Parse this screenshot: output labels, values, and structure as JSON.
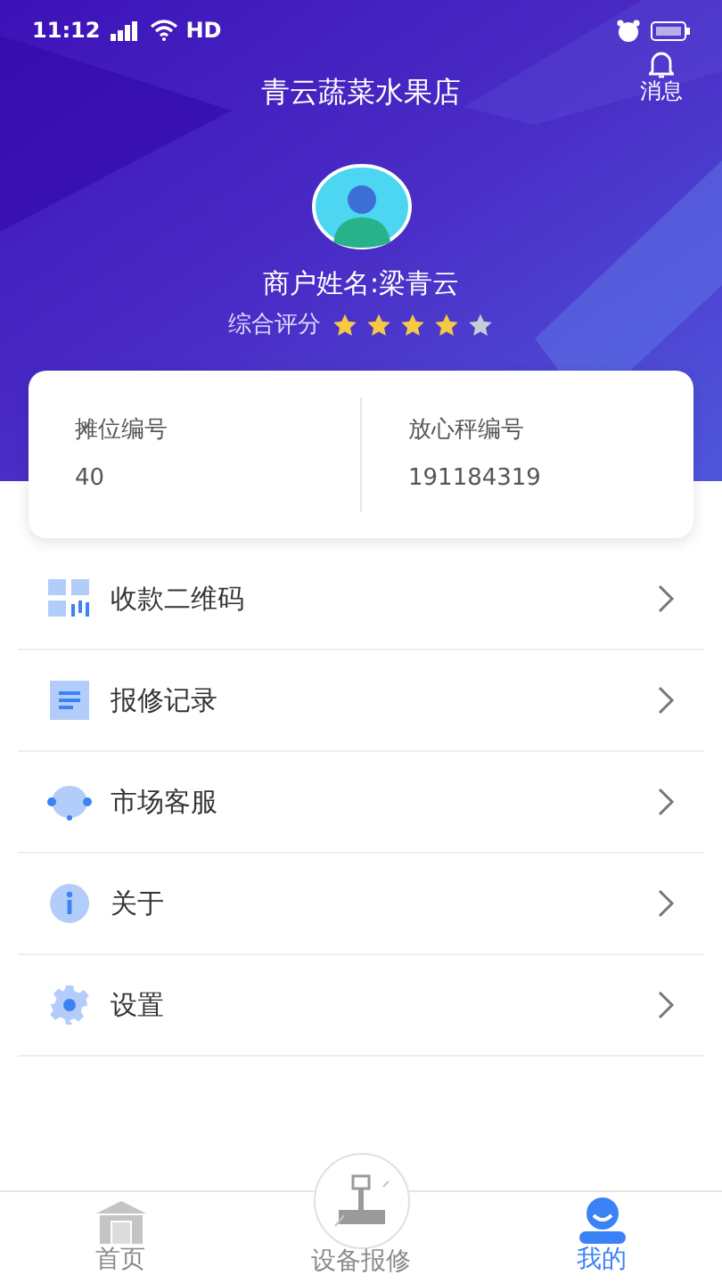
{
  "status_bar": {
    "time": "11:12",
    "network": "HD"
  },
  "header": {
    "title": "青云蔬菜水果店",
    "message_button": "消息"
  },
  "profile": {
    "name": "商户姓名:梁青云",
    "rating_label": "综合评分",
    "stars": 4
  },
  "info_card": [
    {
      "label": "摊位编号",
      "value": "40"
    },
    {
      "label": "放心秤编号",
      "value": "191184319"
    }
  ],
  "menu": [
    {
      "kind": "qrcode",
      "label": "收款二维码"
    },
    {
      "kind": "record",
      "label": "报修记录"
    },
    {
      "kind": "service",
      "label": "市场客服"
    },
    {
      "kind": "about",
      "label": "关于"
    },
    {
      "kind": "settings",
      "label": "设置"
    }
  ],
  "tabs": [
    {
      "kind": "home",
      "label": "首页",
      "selected": false
    },
    {
      "kind": "repair",
      "label": "设备报修",
      "selected": false
    },
    {
      "kind": "me",
      "label": "我的",
      "selected": true
    }
  ]
}
